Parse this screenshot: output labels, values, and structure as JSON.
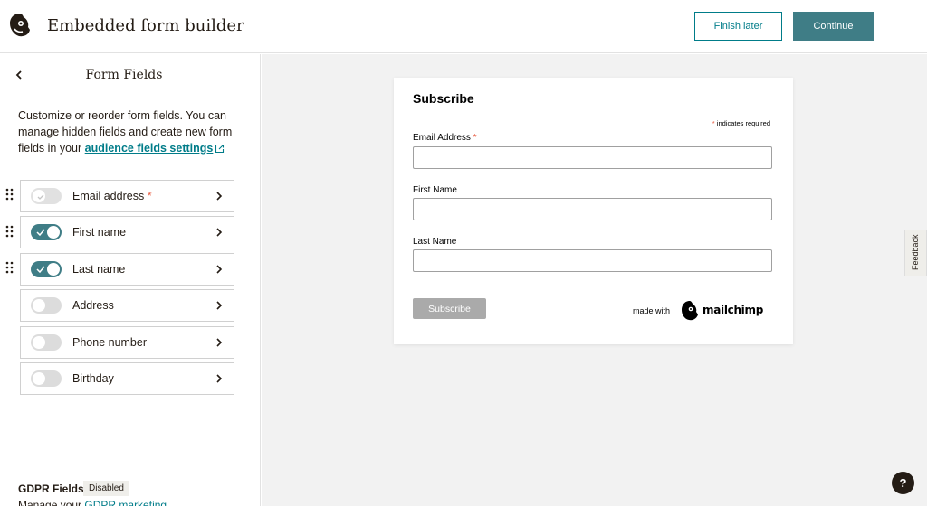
{
  "header": {
    "title": "Embedded form builder",
    "finish_later": "Finish later",
    "continue": "Continue"
  },
  "sidebar": {
    "title": "Form Fields",
    "description": "Customize or reorder form fields. You can manage hidden fields and create new form fields in your ",
    "link": "audience fields settings",
    "fields": [
      {
        "label": "Email address",
        "required": "*",
        "state": "locked"
      },
      {
        "label": "First name",
        "state": "on"
      },
      {
        "label": "Last name",
        "state": "on"
      },
      {
        "label": "Address",
        "state": "off"
      },
      {
        "label": "Phone number",
        "state": "off"
      },
      {
        "label": "Birthday",
        "state": "off"
      }
    ],
    "gdpr": {
      "title": "GDPR Fields",
      "badge": "Disabled",
      "desc_prefix": "Manage your ",
      "desc_link": "GDPR marketing"
    }
  },
  "preview": {
    "title": "Subscribe",
    "required_note_star": "*",
    "required_note": " indicates required",
    "email_label": "Email Address",
    "email_star": "*",
    "first_label": "First Name",
    "last_label": "Last Name",
    "submit": "Subscribe",
    "made_with": "made with",
    "brand": "mailchimp"
  },
  "feedback": "Feedback",
  "help": "?",
  "colors": {
    "accent": "#007c89",
    "toggle_on": "#3f7d86",
    "required": "#e85c41"
  }
}
